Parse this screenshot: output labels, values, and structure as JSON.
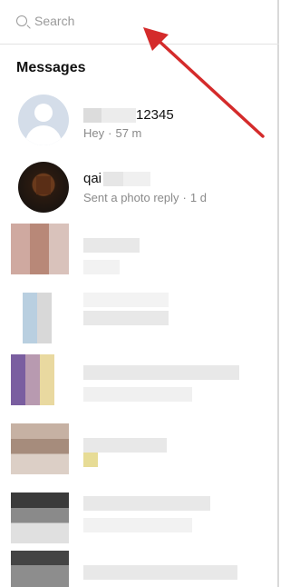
{
  "search": {
    "placeholder": "Search"
  },
  "section_title": "Messages",
  "conversations": [
    {
      "name_suffix": "12345",
      "preview": "Hey",
      "time": "57 m",
      "avatar": "default-avatar"
    },
    {
      "name_prefix": "qai",
      "preview": "Sent a photo reply",
      "time": "1 d",
      "avatar": "photo-avatar"
    }
  ],
  "colors": {
    "arrow": "#d42b2b",
    "avatar_default": "#d4dde9",
    "text_muted": "#8a8a8a"
  },
  "annotation": {
    "type": "arrow",
    "points_to": "search-input"
  }
}
